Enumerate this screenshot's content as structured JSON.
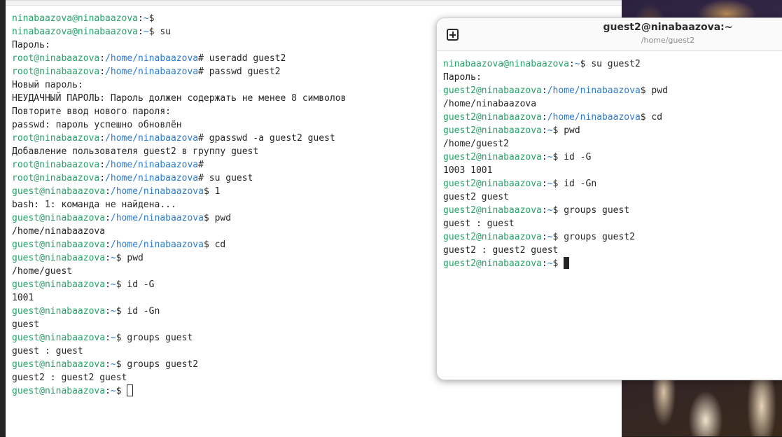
{
  "colors": {
    "user_host": "#26a269",
    "path": "#2a7bd1",
    "text": "#262626"
  },
  "main_terminal": {
    "lines": [
      [
        {
          "t": "ninabaazova@ninabaazova",
          "c": "user"
        },
        {
          "t": ":"
        },
        {
          "t": "~",
          "c": "path"
        },
        {
          "t": "$"
        }
      ],
      [
        {
          "t": "ninabaazova@ninabaazova",
          "c": "user"
        },
        {
          "t": ":"
        },
        {
          "t": "~",
          "c": "path"
        },
        {
          "t": "$ su"
        }
      ],
      [
        {
          "t": "Пароль:"
        }
      ],
      [
        {
          "t": "root@ninabaazova",
          "c": "user"
        },
        {
          "t": ":"
        },
        {
          "t": "/home/ninabaazova",
          "c": "path"
        },
        {
          "t": "# useradd guest2"
        }
      ],
      [
        {
          "t": "root@ninabaazova",
          "c": "user"
        },
        {
          "t": ":"
        },
        {
          "t": "/home/ninabaazova",
          "c": "path"
        },
        {
          "t": "# passwd guest2"
        }
      ],
      [
        {
          "t": "Новый пароль:"
        }
      ],
      [
        {
          "t": "НЕУДАЧНЫЙ ПАРОЛЬ: Пароль должен содержать не менее 8 символов"
        }
      ],
      [
        {
          "t": "Повторите ввод нового пароля:"
        }
      ],
      [
        {
          "t": "passwd: пароль успешно обновлён"
        }
      ],
      [
        {
          "t": "root@ninabaazova",
          "c": "user"
        },
        {
          "t": ":"
        },
        {
          "t": "/home/ninabaazova",
          "c": "path"
        },
        {
          "t": "# gpasswd -a guest2 guest"
        }
      ],
      [
        {
          "t": "Добавление пользователя guest2 в группу guest"
        }
      ],
      [
        {
          "t": "root@ninabaazova",
          "c": "user"
        },
        {
          "t": ":"
        },
        {
          "t": "/home/ninabaazova",
          "c": "path"
        },
        {
          "t": "#"
        }
      ],
      [
        {
          "t": "root@ninabaazova",
          "c": "user"
        },
        {
          "t": ":"
        },
        {
          "t": "/home/ninabaazova",
          "c": "path"
        },
        {
          "t": "# su guest"
        }
      ],
      [
        {
          "t": "guest@ninabaazova",
          "c": "user"
        },
        {
          "t": ":"
        },
        {
          "t": "/home/ninabaazova",
          "c": "path"
        },
        {
          "t": "$ 1"
        }
      ],
      [
        {
          "t": "bash: 1: команда не найдена..."
        }
      ],
      [
        {
          "t": "guest@ninabaazova",
          "c": "user"
        },
        {
          "t": ":"
        },
        {
          "t": "/home/ninabaazova",
          "c": "path"
        },
        {
          "t": "$ pwd"
        }
      ],
      [
        {
          "t": "/home/ninabaazova"
        }
      ],
      [
        {
          "t": "guest@ninabaazova",
          "c": "user"
        },
        {
          "t": ":"
        },
        {
          "t": "/home/ninabaazova",
          "c": "path"
        },
        {
          "t": "$ cd"
        }
      ],
      [
        {
          "t": "guest@ninabaazova",
          "c": "user"
        },
        {
          "t": ":"
        },
        {
          "t": "~",
          "c": "path"
        },
        {
          "t": "$ pwd"
        }
      ],
      [
        {
          "t": "/home/guest"
        }
      ],
      [
        {
          "t": "guest@ninabaazova",
          "c": "user"
        },
        {
          "t": ":"
        },
        {
          "t": "~",
          "c": "path"
        },
        {
          "t": "$ id -G"
        }
      ],
      [
        {
          "t": "1001"
        }
      ],
      [
        {
          "t": "guest@ninabaazova",
          "c": "user"
        },
        {
          "t": ":"
        },
        {
          "t": "~",
          "c": "path"
        },
        {
          "t": "$ id -Gn"
        }
      ],
      [
        {
          "t": "guest"
        }
      ],
      [
        {
          "t": "guest@ninabaazova",
          "c": "user"
        },
        {
          "t": ":"
        },
        {
          "t": "~",
          "c": "path"
        },
        {
          "t": "$ groups guest"
        }
      ],
      [
        {
          "t": "guest : guest"
        }
      ],
      [
        {
          "t": "guest@ninabaazova",
          "c": "user"
        },
        {
          "t": ":"
        },
        {
          "t": "~",
          "c": "path"
        },
        {
          "t": "$ groups guest2"
        }
      ],
      [
        {
          "t": "guest2 : guest2 guest"
        }
      ],
      [
        {
          "t": "guest@ninabaazova",
          "c": "user"
        },
        {
          "t": ":"
        },
        {
          "t": "~",
          "c": "path"
        },
        {
          "t": "$ "
        },
        {
          "cursor": "box"
        }
      ]
    ]
  },
  "float_terminal": {
    "title": "guest2@ninabaazova:~",
    "subtitle": "/home/guest2",
    "new_tab_icon": "new-tab-icon",
    "lines": [
      [
        {
          "t": "ninabaazova@ninabaazova",
          "c": "user"
        },
        {
          "t": ":"
        },
        {
          "t": "~",
          "c": "path"
        },
        {
          "t": "$ su guest2"
        }
      ],
      [
        {
          "t": "Пароль:"
        }
      ],
      [
        {
          "t": "guest2@ninabaazova",
          "c": "user"
        },
        {
          "t": ":"
        },
        {
          "t": "/home/ninabaazova",
          "c": "path"
        },
        {
          "t": "$ pwd"
        }
      ],
      [
        {
          "t": "/home/ninabaazova"
        }
      ],
      [
        {
          "t": "guest2@ninabaazova",
          "c": "user"
        },
        {
          "t": ":"
        },
        {
          "t": "/home/ninabaazova",
          "c": "path"
        },
        {
          "t": "$ cd"
        }
      ],
      [
        {
          "t": "guest2@ninabaazova",
          "c": "user"
        },
        {
          "t": ":"
        },
        {
          "t": "~",
          "c": "path"
        },
        {
          "t": "$ pwd"
        }
      ],
      [
        {
          "t": "/home/guest2"
        }
      ],
      [
        {
          "t": "guest2@ninabaazova",
          "c": "user"
        },
        {
          "t": ":"
        },
        {
          "t": "~",
          "c": "path"
        },
        {
          "t": "$ id -G"
        }
      ],
      [
        {
          "t": "1003 1001"
        }
      ],
      [
        {
          "t": "guest2@ninabaazova",
          "c": "user"
        },
        {
          "t": ":"
        },
        {
          "t": "~",
          "c": "path"
        },
        {
          "t": "$ id -Gn"
        }
      ],
      [
        {
          "t": "guest2 guest"
        }
      ],
      [
        {
          "t": "guest2@ninabaazova",
          "c": "user"
        },
        {
          "t": ":"
        },
        {
          "t": "~",
          "c": "path"
        },
        {
          "t": "$ groups guest"
        }
      ],
      [
        {
          "t": "guest : guest"
        }
      ],
      [
        {
          "t": "guest2@ninabaazova",
          "c": "user"
        },
        {
          "t": ":"
        },
        {
          "t": "~",
          "c": "path"
        },
        {
          "t": "$ groups guest2"
        }
      ],
      [
        {
          "t": "guest2 : guest2 guest"
        }
      ],
      [
        {
          "t": "guest2@ninabaazova",
          "c": "user"
        },
        {
          "t": ":"
        },
        {
          "t": "~",
          "c": "path"
        },
        {
          "t": "$ "
        },
        {
          "cursor": "solid"
        }
      ]
    ]
  }
}
